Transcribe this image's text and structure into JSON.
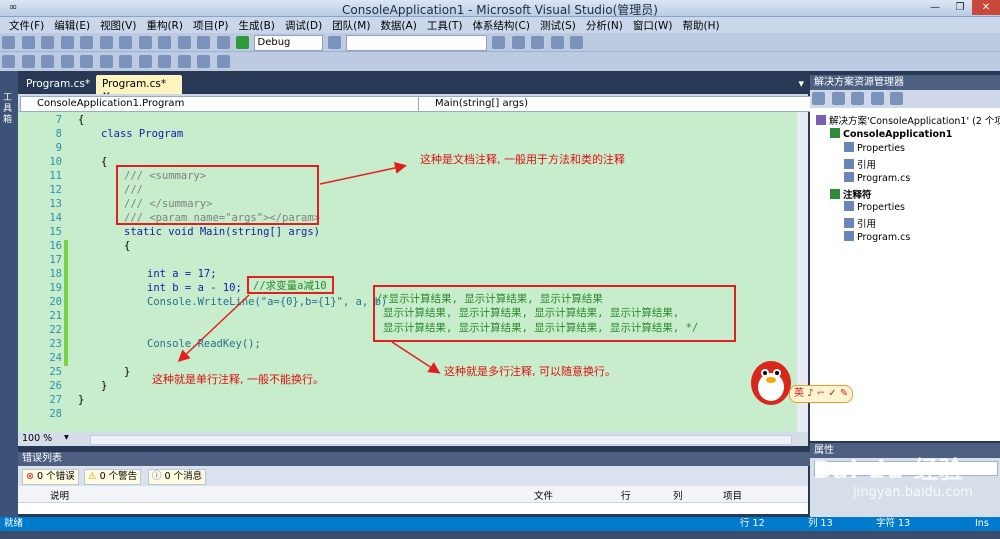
{
  "window": {
    "title": "ConsoleApplication1 - Microsoft Visual Studio(管理员)"
  },
  "menu": [
    "文件(F)",
    "编辑(E)",
    "视图(V)",
    "重构(R)",
    "项目(P)",
    "生成(B)",
    "调试(D)",
    "团队(M)",
    "数据(A)",
    "工具(T)",
    "体系结构(C)",
    "测试(S)",
    "分析(N)",
    "窗口(W)",
    "帮助(H)"
  ],
  "toolbar": {
    "config": "Debug",
    "left_tool_label": "工具箱"
  },
  "tabs": [
    {
      "label": "Program.cs*"
    },
    {
      "label": "Program.cs*"
    }
  ],
  "navbar": {
    "class_select": "ConsoleApplication1.Program",
    "member_select": "Main(string[] args)"
  },
  "code_lines": [
    {
      "n": "7",
      "text": "{"
    },
    {
      "n": "8",
      "text": "class Program"
    },
    {
      "n": "9",
      "text": ""
    },
    {
      "n": "10",
      "text": "{"
    },
    {
      "n": "11",
      "text": "/// <summary>"
    },
    {
      "n": "12",
      "text": "///"
    },
    {
      "n": "13",
      "text": "/// </summary>"
    },
    {
      "n": "14",
      "text": "/// <param name=\"args\"></param>"
    },
    {
      "n": "15",
      "text": "static void Main(string[] args)"
    },
    {
      "n": "16",
      "text": "{"
    },
    {
      "n": "17",
      "text": ""
    },
    {
      "n": "18",
      "text": "int a = 17;"
    },
    {
      "n": "19",
      "text": "int b = a - 10;"
    },
    {
      "n": "20",
      "text": "Console.WriteLine(\"a={0},b={1}\", a, b)"
    },
    {
      "n": "21",
      "text": ""
    },
    {
      "n": "22",
      "text": ""
    },
    {
      "n": "23",
      "text": "Console.ReadKey();"
    },
    {
      "n": "24",
      "text": ""
    },
    {
      "n": "25",
      "text": "}"
    },
    {
      "n": "26",
      "text": "}"
    },
    {
      "n": "27",
      "text": "}"
    },
    {
      "n": "28",
      "text": ""
    }
  ],
  "inline_comment": "//求变量a减10",
  "multiline_comment": [
    "/*显示计算结果, 显示计算结果, 显示计算结果",
    "显示计算结果, 显示计算结果, 显示计算结果, 显示计算结果,",
    "显示计算结果, 显示计算结果, 显示计算结果, 显示计算结果, */"
  ],
  "annotations": {
    "doc": "这种是文档注释, 一般用于方法和类的注释",
    "single": "这种就是单行注释, 一般不能换行。",
    "multi": "这种就是多行注释, 可以随意换行。"
  },
  "zoom": "100 %",
  "error_list": {
    "title": "错误列表",
    "errors": "0 个错误",
    "warnings": "0 个警告",
    "messages": "0 个消息",
    "columns": [
      "说明",
      "文件",
      "行",
      "列",
      "项目"
    ]
  },
  "solution_explorer": {
    "title": "解决方案资源管理器",
    "items": [
      {
        "label": "解决方案'ConsoleApplication1' (2 个项",
        "indent": 0
      },
      {
        "label": "ConsoleApplication1",
        "indent": 1
      },
      {
        "label": "Properties",
        "indent": 2
      },
      {
        "label": "引用",
        "indent": 2
      },
      {
        "label": "Program.cs",
        "indent": 2
      },
      {
        "label": "注释符",
        "indent": 1
      },
      {
        "label": "Properties",
        "indent": 2
      },
      {
        "label": "引用",
        "indent": 2
      },
      {
        "label": "Program.cs",
        "indent": 2
      }
    ]
  },
  "properties": {
    "title": "属性"
  },
  "status": {
    "left": "就绪",
    "row": "行 12",
    "col": "列 13",
    "char": "字符 13",
    "mode": "Ins"
  },
  "watermark": {
    "brand": "Bai du 经验",
    "url": "jingyan.baidu.com"
  },
  "qq_widget": {
    "label": "英 ♪ ⌐ ✓ ✎"
  }
}
